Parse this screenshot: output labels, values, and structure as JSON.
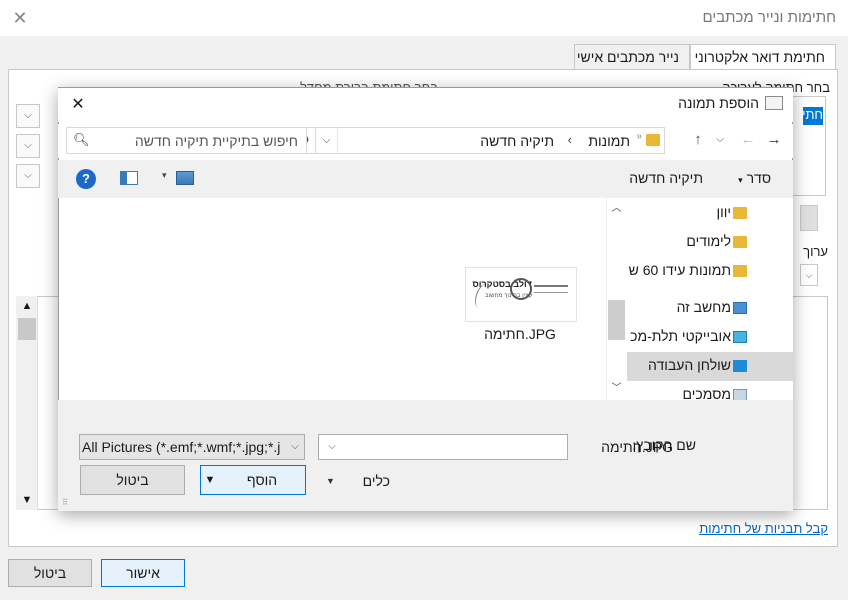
{
  "outer_dialog": {
    "title": "חתימות ונייר מכתבים",
    "tabs": [
      {
        "label": "חתימת דואר אלקטרוני",
        "selected": true
      },
      {
        "label": "נייר מכתבים אישי",
        "selected": false
      }
    ],
    "select_signature_label": "בחר חתימה לעריכה",
    "signature_list_selected": "חתי",
    "default_signature_label": "בחר חתימת ברירת מחדל",
    "edit_signature_label": "ערוך חתימה",
    "get_templates_link": "קבל תבניות של חתימות",
    "ok_label": "אישור",
    "cancel_label": "ביטול"
  },
  "insert_picture_dialog": {
    "title": "הוספת תמונה",
    "breadcrumb": [
      "תמונות",
      "תיקיה חדשה"
    ],
    "search_placeholder": "חיפוש בתיקיית תיקיה חדשה",
    "toolbar": {
      "organize": "סדר",
      "new_folder": "תיקיה חדשה"
    },
    "nav_items": [
      {
        "label": "יוון",
        "icon": "folder-icon",
        "selected": false
      },
      {
        "label": "לימודים",
        "icon": "folder-icon",
        "selected": false
      },
      {
        "label": "תמונות עידו 60 ש",
        "icon": "folder-icon",
        "selected": false
      },
      {
        "label": "מחשב זה",
        "icon": "computer-icon",
        "selected": false
      },
      {
        "label": "אובייקטי תלת-מכ",
        "icon": "3d-objects-icon",
        "selected": false
      },
      {
        "label": "שולחן העבודה",
        "icon": "desktop-icon",
        "selected": true
      },
      {
        "label": "מסמכים",
        "icon": "documents-icon",
        "selected": false
      }
    ],
    "file": {
      "name": "חתימה.JPG",
      "thumbnail_text": "דולב בסטקרוס",
      "thumbnail_subtext": "קצין בחינוך מחשוב"
    },
    "filename_label": "שם הקובץ:",
    "filename_value": "חתימה.JPG",
    "filetype_value": "All Pictures (*.emf;*.wmf;*.jpg;*.j",
    "tools_label": "כלים",
    "insert_label": "הוסף",
    "cancel_label": "ביטול"
  }
}
